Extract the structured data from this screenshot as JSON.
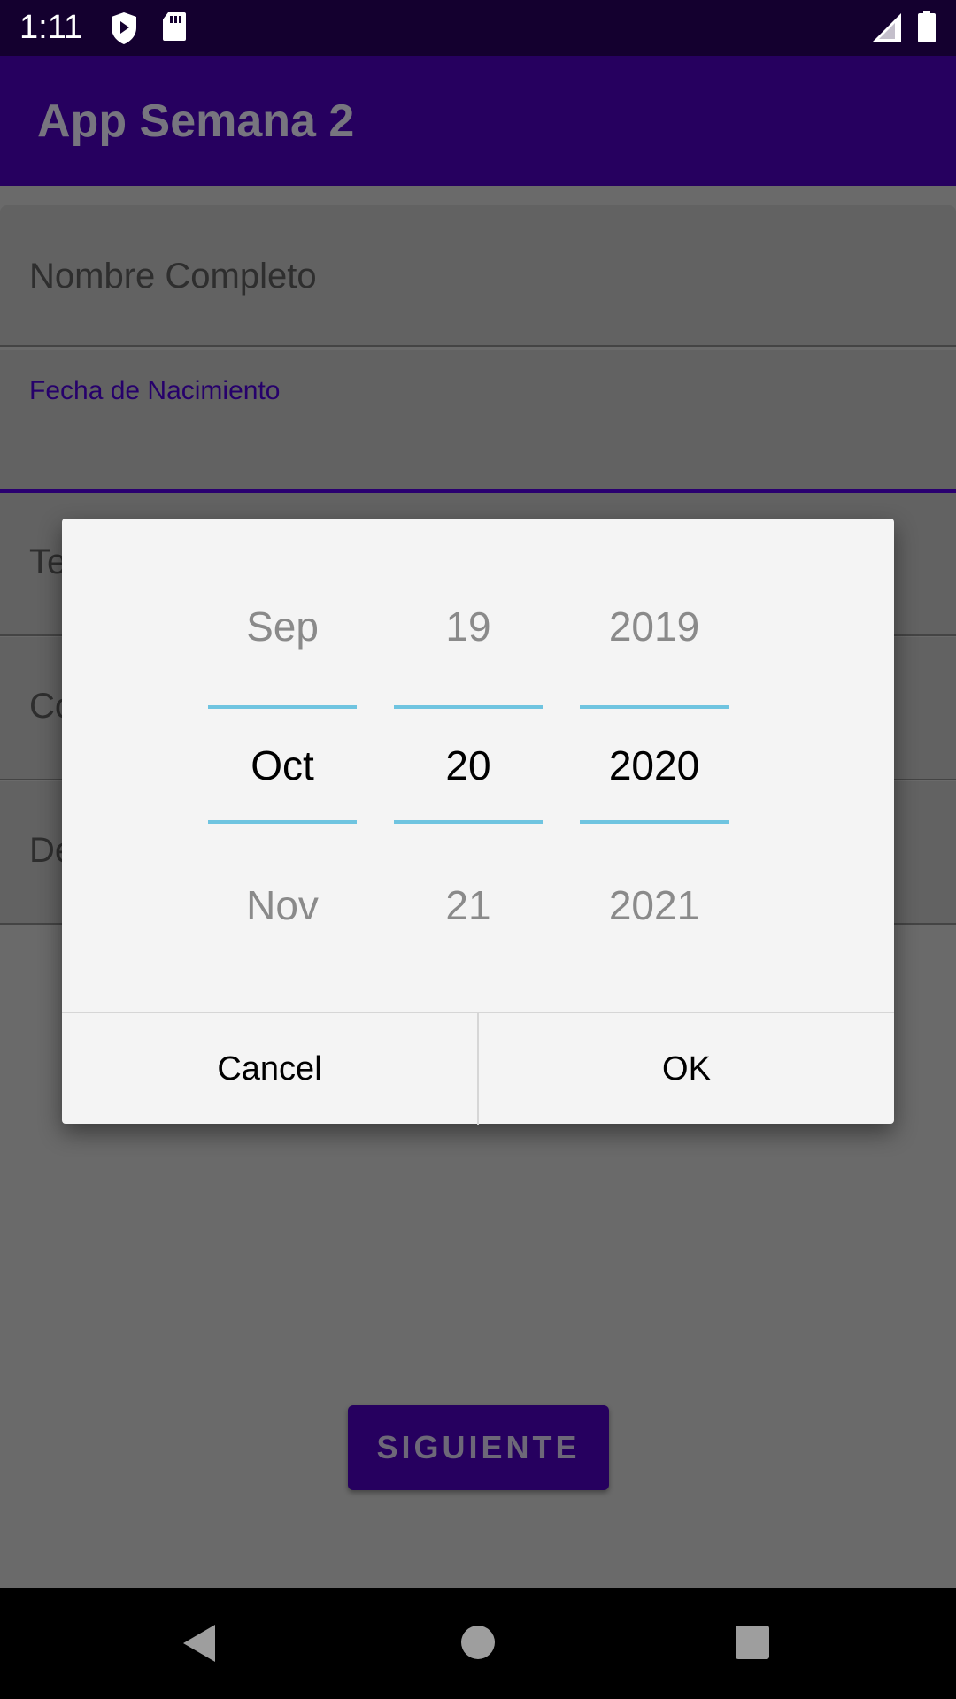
{
  "status_bar": {
    "time": "1:11"
  },
  "app_bar": {
    "title": "App Semana 2"
  },
  "form": {
    "full_name_placeholder": "Nombre Completo",
    "birth_date_label": "Fecha de Nacimiento",
    "field3_partial": "Te",
    "field4_partial": "Co",
    "field5_partial": "De",
    "next_button": "SIGUIENTE"
  },
  "date_picker": {
    "month": {
      "prev": "Sep",
      "current": "Oct",
      "next": "Nov"
    },
    "day": {
      "prev": "19",
      "current": "20",
      "next": "21"
    },
    "year": {
      "prev": "2019",
      "current": "2020",
      "next": "2021"
    },
    "cancel_label": "Cancel",
    "ok_label": "OK"
  },
  "colors": {
    "primary": "#26005f",
    "status_bar": "#14002f",
    "picker_divider": "#6fc4e0"
  }
}
